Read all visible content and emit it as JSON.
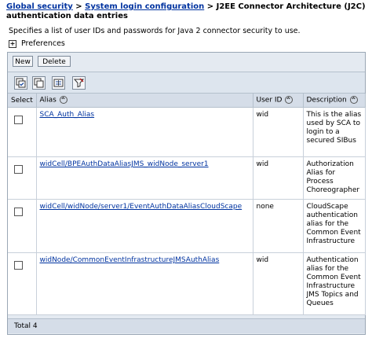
{
  "breadcrumb": {
    "link1": "Global security",
    "sep1": ">",
    "link2": "System login configuration",
    "sep2": ">",
    "current": "J2EE Connector Architecture (J2C) authentication data entries"
  },
  "description": "Specifies a list of user IDs and passwords for Java 2 connector security to use.",
  "preferences": {
    "expander": "+",
    "label": "Preferences"
  },
  "buttons": {
    "new": "New",
    "delete": "Delete"
  },
  "toolbar_icons": [
    "select-all-icon",
    "deselect-all-icon",
    "show-filter-icon",
    "clear-filter-icon"
  ],
  "table": {
    "headers": {
      "select": "Select",
      "alias": "Alias",
      "user_id": "User ID",
      "description": "Description"
    },
    "rows": [
      {
        "alias": "SCA_Auth_Alias",
        "user_id": "wid",
        "description": "This is the alias used by SCA to login to a secured SIBus"
      },
      {
        "alias": "widCell/BPEAuthDataAliasJMS_widNode_server1",
        "user_id": "wid",
        "description": "Authorization Alias for Process Choreographer"
      },
      {
        "alias": "widCell/widNode/server1/EventAuthDataAliasCloudScape",
        "user_id": "none",
        "description": "CloudScape authentication alias for the Common Event Infrastructure"
      },
      {
        "alias": "widNode/CommonEventInfrastructureJMSAuthAlias",
        "user_id": "wid",
        "description": "Authentication alias for the Common Event Infrastructure JMS Topics and Queues"
      }
    ],
    "total": "Total 4"
  }
}
